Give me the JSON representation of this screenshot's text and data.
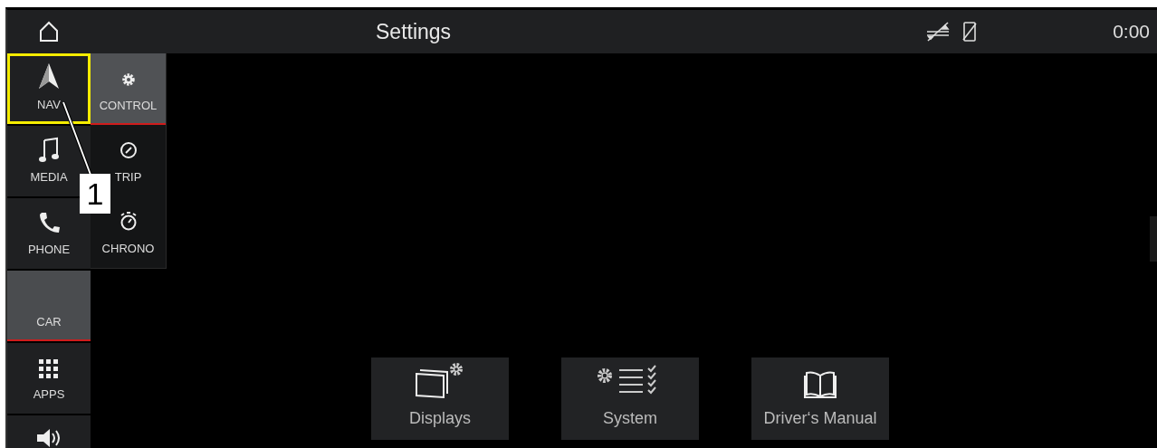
{
  "header": {
    "title": "Settings",
    "time": "0:00"
  },
  "sidebar": {
    "items": [
      {
        "kind": "nav",
        "label": "NAV",
        "selected": false,
        "highlighted": true
      },
      {
        "kind": "media",
        "label": "MEDIA",
        "selected": false,
        "highlighted": false
      },
      {
        "kind": "phone",
        "label": "PHONE",
        "selected": false,
        "highlighted": false
      },
      {
        "kind": "car",
        "label": "CAR",
        "selected": true,
        "highlighted": false
      },
      {
        "kind": "apps",
        "label": "APPS",
        "selected": false,
        "highlighted": false
      },
      {
        "kind": "volume",
        "selected": false,
        "highlighted": false
      }
    ]
  },
  "submenu": {
    "items": [
      {
        "kind": "control",
        "label": "CONTROL",
        "selected": true
      },
      {
        "kind": "trip",
        "label": "TRIP",
        "selected": false
      },
      {
        "kind": "chrono",
        "label": "CHRONO",
        "selected": false
      }
    ]
  },
  "callout": {
    "label": "1"
  },
  "tiles": [
    {
      "kind": "displays",
      "label": "Displays"
    },
    {
      "kind": "system",
      "label": "System"
    },
    {
      "kind": "manual",
      "label": "Driver‘s Manual"
    }
  ]
}
